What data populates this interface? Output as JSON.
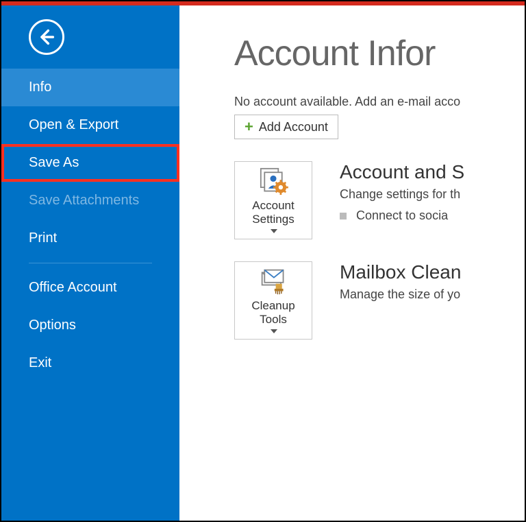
{
  "sidebar": {
    "items": [
      {
        "label": "Info",
        "state": "selected"
      },
      {
        "label": "Open & Export",
        "state": "normal"
      },
      {
        "label": "Save As",
        "state": "highlight"
      },
      {
        "label": "Save Attachments",
        "state": "disabled"
      },
      {
        "label": "Print",
        "state": "normal"
      },
      {
        "label": "Office Account",
        "state": "normal"
      },
      {
        "label": "Options",
        "state": "normal"
      },
      {
        "label": "Exit",
        "state": "normal"
      }
    ]
  },
  "main": {
    "title": "Account Infor",
    "no_account_text": "No account available. Add an e-mail acco",
    "add_account_label": "Add Account",
    "account_settings": {
      "tile_label": "Account Settings",
      "title": "Account and S",
      "desc": "Change settings for th",
      "bullet": "Connect to socia"
    },
    "cleanup": {
      "tile_label": "Cleanup Tools",
      "title": "Mailbox Clean",
      "desc": "Manage the size of yo"
    }
  }
}
